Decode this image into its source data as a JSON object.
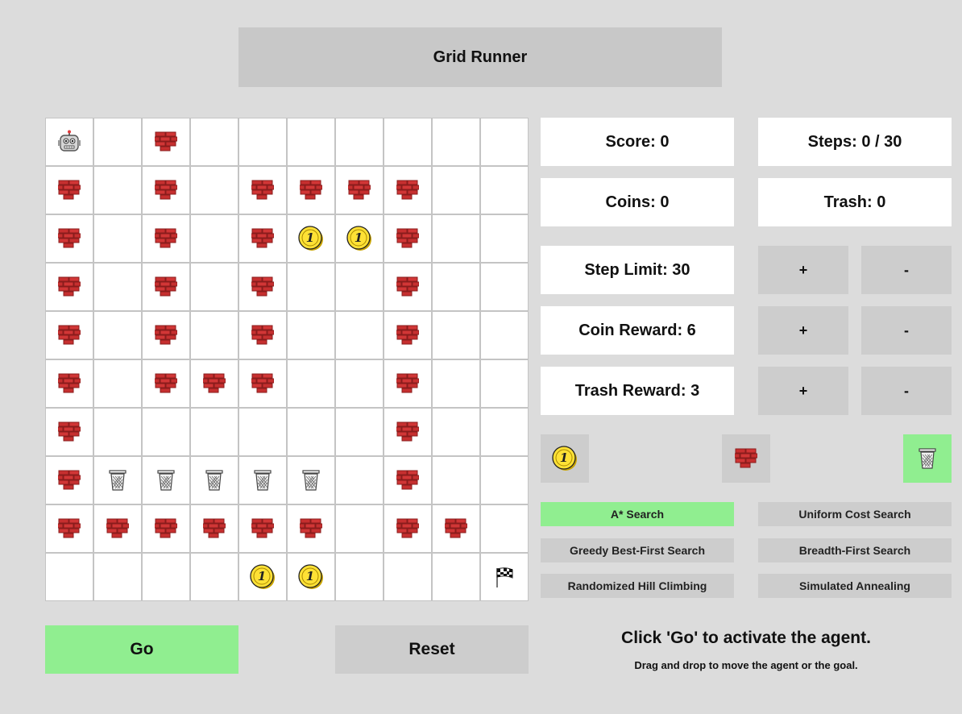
{
  "title": "Grid Runner",
  "stats": {
    "score": "Score: 0",
    "steps": "Steps: 0 / 30",
    "coins": "Coins: 0",
    "trash": "Trash: 0"
  },
  "settings": [
    {
      "key": "step_limit",
      "label": "Step Limit: 30",
      "plus": "+",
      "minus": "-"
    },
    {
      "key": "coin_reward",
      "label": "Coin Reward: 6",
      "plus": "+",
      "minus": "-"
    },
    {
      "key": "trash_reward",
      "label": "Trash Reward: 3",
      "plus": "+",
      "minus": "-"
    }
  ],
  "tools": [
    {
      "icon": "coin-icon",
      "selected": false
    },
    {
      "icon": "brick-wall-icon",
      "selected": false
    },
    {
      "icon": "trash-can-icon",
      "selected": true
    }
  ],
  "algorithms": [
    {
      "label": "A* Search",
      "selected": true
    },
    {
      "label": "Uniform Cost Search",
      "selected": false
    },
    {
      "label": "Greedy Best-First Search",
      "selected": false
    },
    {
      "label": "Breadth-First Search",
      "selected": false
    },
    {
      "label": "Randomized Hill Climbing",
      "selected": false
    },
    {
      "label": "Simulated Annealing",
      "selected": false
    }
  ],
  "buttons": {
    "go": "Go",
    "reset": "Reset"
  },
  "messages": {
    "primary": "Click 'Go' to activate the agent.",
    "secondary": "Drag and drop to move the agent or the goal."
  },
  "legend": {
    "R": "robot-agent-icon",
    "W": "brick-wall-icon",
    "C": "coin-icon",
    "T": "trash-can-icon",
    "G": "checkered-flag-icon",
    ".": "empty"
  },
  "grid": [
    "R.W.......",
    "W.W.WWWW..",
    "W.W.WCCW..",
    "W.W.W..W..",
    "W.W.W..W..",
    "W.WWW..W..",
    "W......W..",
    "WTTTTT.W..",
    "WWWWWW.WW.",
    "....CC...G"
  ]
}
